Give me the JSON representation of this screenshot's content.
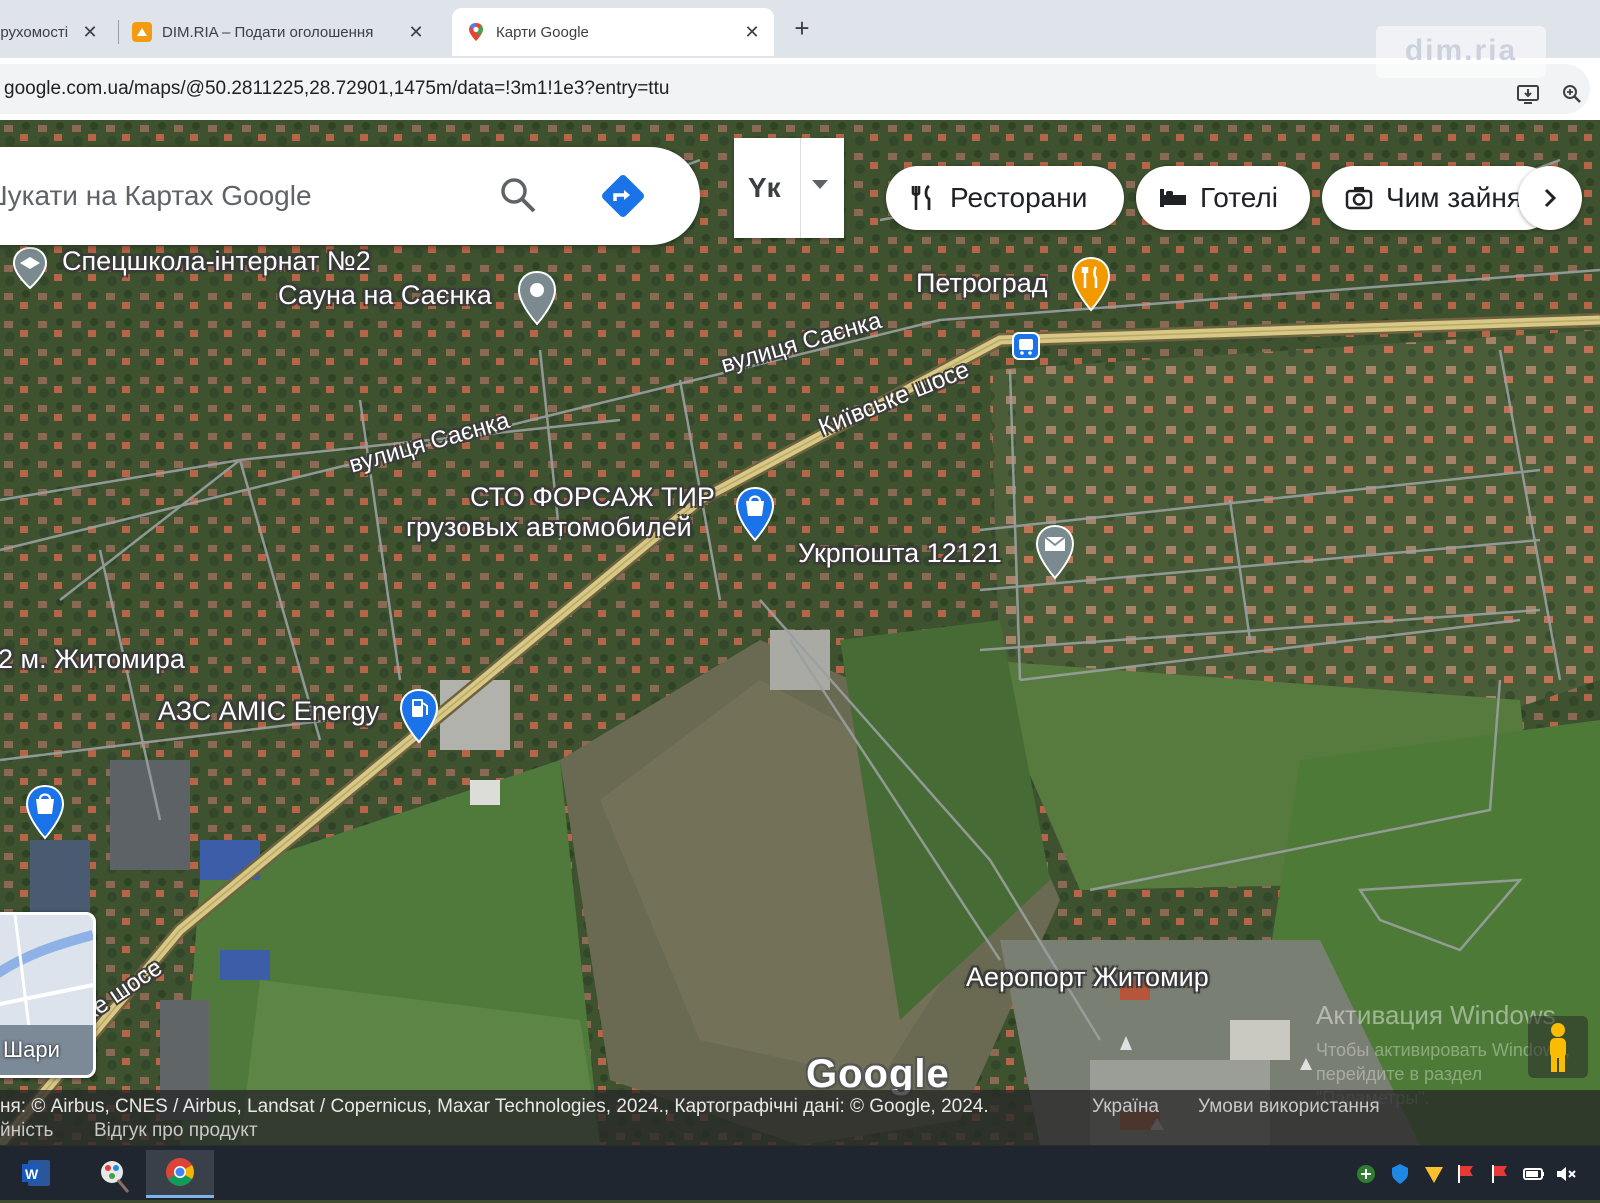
{
  "browser": {
    "tabs": [
      {
        "title": "ерухомості",
        "favicon": "real-estate-favicon"
      },
      {
        "title": "DIM.RIA – Подати оголошення",
        "favicon": "dim-ria-favicon"
      },
      {
        "title": "Карти Google",
        "favicon": "google-maps-pin-favicon",
        "active": true
      }
    ],
    "new_tab": "+",
    "url": "google.com.ua/maps/@50.2811225,28.72901,1475m/data=!3m1!1e3?entry=ttu",
    "watermark": "dim.ria"
  },
  "map": {
    "search_placeholder": "Шукати на Картах Google",
    "language_label": "Yк",
    "chips": [
      {
        "label": "Ресторани",
        "icon": "fork-knife-icon"
      },
      {
        "label": "Готелі",
        "icon": "bed-icon"
      },
      {
        "label": "Чим зайнятися",
        "icon": "camera-icon"
      }
    ],
    "places": [
      {
        "name": "Спецшкола-інтернат №2",
        "icon": "school-icon"
      },
      {
        "name": "Сауна на Саєнка",
        "icon": "place-pin"
      },
      {
        "name": "Петроград",
        "icon": "restaurant-pin"
      },
      {
        "name": "СТО ФОРСАЖ ТИР",
        "icon": "shopping-pin"
      },
      {
        "name": "грузовых автомобилей",
        "icon": ""
      },
      {
        "name": "Укрпошта 12121",
        "icon": "mail-pin"
      },
      {
        "name": "2 м. Житомира",
        "icon": ""
      },
      {
        "name": "АЗС AMIC Energy",
        "icon": "gas-station-pin"
      },
      {
        "name": "Аеропорт Житомир",
        "icon": ""
      }
    ],
    "roads": {
      "saienka_1": "вулиця Саєнка",
      "saienka_2": "вулиця Саєнка",
      "kyivske_1": "Київське шосе",
      "kyivske_2": "ське шосе"
    },
    "layers_label": "Шари",
    "logo": "Google",
    "attribution": "ня: © Airbus, CNES / Airbus, Landsat / Copernicus, Maxar Technologies, 2024., Картографічні дані: © Google, 2024.",
    "links": [
      "Україна",
      "Умови використання"
    ],
    "links_row2": [
      "йність",
      "Відгук про продукт"
    ],
    "windows_activation": "Активация Windows",
    "windows_activation_sub": "Чтобы активировать Windows, перейдите в раздел \"Параметры\"."
  },
  "colors": {
    "accent_blue": "#1a73e8",
    "highway": "#d8c886",
    "taskbar": "#1f2630"
  },
  "taskbar": {
    "apps": [
      "word-icon",
      "paint-icon",
      "chrome-icon"
    ],
    "tray": [
      "network-icon",
      "security-icon",
      "antivirus-icon",
      "flag-icon",
      "flag-icon",
      "battery-icon",
      "mute-icon"
    ]
  }
}
